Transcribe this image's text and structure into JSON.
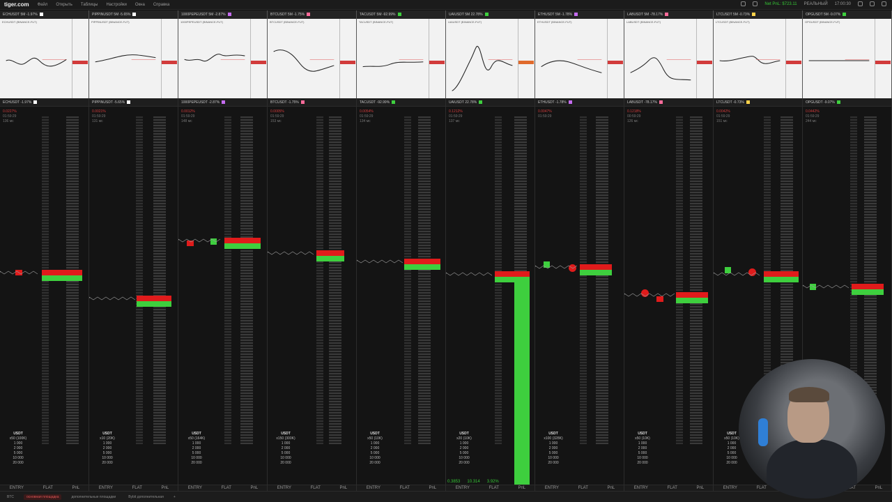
{
  "app": {
    "logo": "tiger.com",
    "menu": [
      "Файл",
      "Открыть",
      "Таблицы",
      "Настройки",
      "Окна",
      "Справка"
    ],
    "mode": "РЕАЛЬНЫЙ",
    "net_pnl": "Net PnL: $723.11",
    "time": "17:00:30"
  },
  "minis": [
    {
      "title": "ECHUSDT 5M -1.97%",
      "sub": "ECHUSDT (BINANCE-FUT)",
      "color": "#ffffff"
    },
    {
      "title": "PIPPINUSDT 5M -5.65%",
      "sub": "PIPPINUSDT (BINANCE-FUT)",
      "color": "#ffffff"
    },
    {
      "title": "1000PEPEUSDT 5M -2.87%",
      "sub": "1000PEPEUSDT (BINANCE-FUT)",
      "color": "#c56cf0"
    },
    {
      "title": "BTCUSDT 5M -1.75%",
      "sub": "BTCUSDT (BINANCE-FUT)",
      "color": "#ff6b9a"
    },
    {
      "title": "TACUSDT 5M -92.99%",
      "sub": "TACUSDT (BINANCE-FUT)",
      "color": "#3ecf3e"
    },
    {
      "title": "UAIUSDT 5M 22.78%",
      "sub": "UAIUSDT (BINANCE-FUT)",
      "color": "#3ecf3e"
    },
    {
      "title": "ETHUSDT 5M -1.78%",
      "sub": "ETHUSDT (BINANCE-FUT)",
      "color": "#c56cf0"
    },
    {
      "title": "LABUSDT 5M -78.17%",
      "sub": "LABUSDT (BINANCE-FUT)",
      "color": "#ff6b9a"
    },
    {
      "title": "LTCUSDT 5M -0.73%",
      "sub": "LTCUSDT (BINANCE-FUT)",
      "color": "#ffd24a"
    },
    {
      "title": "OPGUSDT 5M -9.07%",
      "sub": "OPGUSDT (BINANCE-FUT)",
      "color": "#3ecf3e"
    }
  ],
  "panels": [
    {
      "title": "ECHUSDT -1.97%",
      "info1": "0.0227%",
      "info2": "01:59:29",
      "info3": "136 мс",
      "ctrl_title": "USDT",
      "ctrl1": "x50 (100K)",
      "amounts": [
        "1 000",
        "2 000",
        "5 000",
        "10 000",
        "20 000"
      ]
    },
    {
      "title": "PIPPINUSDT -5.65%",
      "info1": "0.0021%",
      "info2": "01:59:29",
      "info3": "131 мс",
      "ctrl_title": "USDT",
      "ctrl1": "x10 (20K)",
      "amounts": [
        "1 000",
        "2 000",
        "5 000",
        "10 000",
        "20 000"
      ]
    },
    {
      "title": "1000PEPEUSDT -2.87%",
      "info1": "0.0012%",
      "info2": "01:59:29",
      "info3": "148 мс",
      "ctrl_title": "USDT",
      "ctrl1": "x50 (164K)",
      "amounts": [
        "1 000",
        "2 000",
        "5 000",
        "10 000",
        "20 000"
      ]
    },
    {
      "title": "BTCUSDT -1.75%",
      "info1": "0.0005%",
      "info2": "01:59:29",
      "info3": "153 мс",
      "ctrl_title": "USDT",
      "ctrl1": "x150 (300K)",
      "amounts": [
        "1 000",
        "2 000",
        "5 000",
        "10 000",
        "20 000"
      ]
    },
    {
      "title": "TACUSDT -92.99%",
      "info1": "0.0054%",
      "info2": "01:59:29",
      "info3": "134 мс",
      "ctrl_title": "USDT",
      "ctrl1": "x50 (10K)",
      "amounts": [
        "1 000",
        "2 000",
        "5 000",
        "10 000",
        "20 000"
      ]
    },
    {
      "title": "UAIUSDT 22.78%",
      "info1": "0.1212%",
      "info2": "01:59:29",
      "info3": "137 мс",
      "ctrl_title": "USDT",
      "ctrl1": "x20 (10K)",
      "amounts": [
        "1 000",
        "2 000",
        "5 000",
        "10 000",
        "20 000"
      ]
    },
    {
      "title": "ETHUSDT -1.78%",
      "info1": "0.0047%",
      "info2": "01:59:29",
      "info3": "",
      "ctrl_title": "USDT",
      "ctrl1": "x100 (328K)",
      "amounts": [
        "1 000",
        "2 000",
        "5 000",
        "10 000",
        "20 000"
      ]
    },
    {
      "title": "LABUSDT -78.17%",
      "info1": "0.1218%",
      "info2": "00:59:29",
      "info3": "126 мс",
      "ctrl_title": "USDT",
      "ctrl1": "x50 (10K)",
      "amounts": [
        "1 000",
        "2 000",
        "5 000",
        "10 000",
        "20 000"
      ]
    },
    {
      "title": "LTCUSDT -0.73%",
      "info1": "0.0042%",
      "info2": "01:59:29",
      "info3": "151 мс",
      "ctrl_title": "USDT",
      "ctrl1": "x50 (10K)",
      "amounts": [
        "1 000",
        "2 000",
        "5 000",
        "10 000",
        "20 000"
      ]
    },
    {
      "title": "OPGUSDT -9.07%",
      "info1": "0.0442%",
      "info2": "01:59:29",
      "info3": "244 мс",
      "ctrl_title": "",
      "ctrl1": "",
      "amounts": []
    }
  ],
  "footer_labels": [
    "ENTRY",
    "FLAT",
    "PnL"
  ],
  "uai_pnl": "0.3853",
  "uai_pnl2": "10.314",
  "uai_pnl3": "3.92%",
  "status_tabs": [
    "BTC",
    "основная площадка",
    "дополнительные площадки",
    "Bybit дополнительная"
  ],
  "colors": {
    "bid": "#3ecf3e",
    "ask": "#e01b1b",
    "bg": "#141414"
  }
}
